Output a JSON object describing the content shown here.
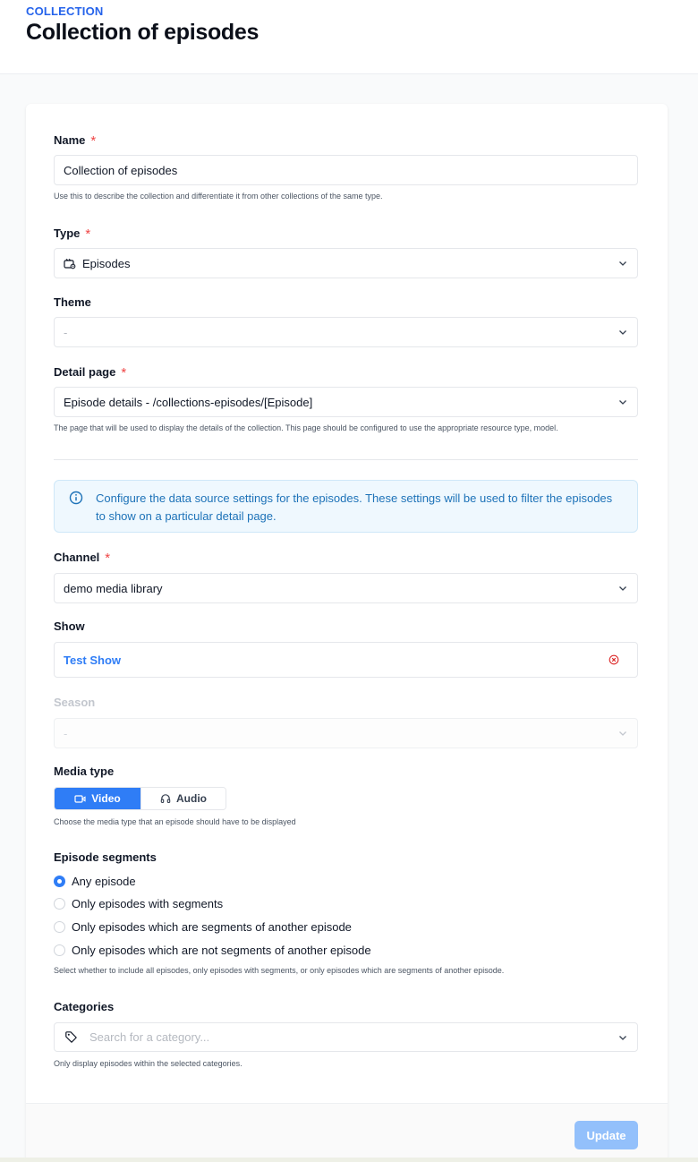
{
  "header": {
    "eyebrow": "COLLECTION",
    "title": "Collection of episodes"
  },
  "form": {
    "name": {
      "label": "Name",
      "required_mark": "*",
      "value": "Collection of episodes",
      "help": "Use this to describe the collection and differentiate it from other collections of the same type."
    },
    "type": {
      "label": "Type",
      "required_mark": "*",
      "value": "Episodes",
      "icon": "episodes-icon"
    },
    "theme": {
      "label": "Theme",
      "value": "-"
    },
    "detail_page": {
      "label": "Detail page",
      "required_mark": "*",
      "value": "Episode details - /collections-episodes/[Episode]",
      "help": "The page that will be used to display the details of the collection. This page should be configured to use the appropriate resource type, model."
    },
    "info": {
      "text": "Configure the data source settings for the episodes. These settings will be used to filter the episodes to show on a particular detail page.",
      "icon": "info-icon"
    },
    "channel": {
      "label": "Channel",
      "required_mark": "*",
      "value": "demo media library"
    },
    "show": {
      "label": "Show",
      "value": "Test Show"
    },
    "season": {
      "label": "Season",
      "value": "-"
    },
    "media_type": {
      "label": "Media type",
      "options": [
        "Video",
        "Audio"
      ],
      "selected": "Video",
      "help": "Choose the media type that an episode should have to be displayed"
    },
    "segments": {
      "label": "Episode segments",
      "options": [
        "Any episode",
        "Only episodes with segments",
        "Only episodes which are segments of another episode",
        "Only episodes which are not segments of another episode"
      ],
      "selected": "Any episode",
      "help": "Select whether to include all episodes, only episodes with segments, or only episodes which are segments of another episode."
    },
    "categories": {
      "label": "Categories",
      "placeholder": "Search for a category...",
      "help": "Only display episodes within the selected categories."
    }
  },
  "footer": {
    "update_label": "Update"
  },
  "colors": {
    "accent": "#2f7df6",
    "required": "#ef4444",
    "info_text": "#1d72b8",
    "update_disabled": "#93c0fb"
  }
}
